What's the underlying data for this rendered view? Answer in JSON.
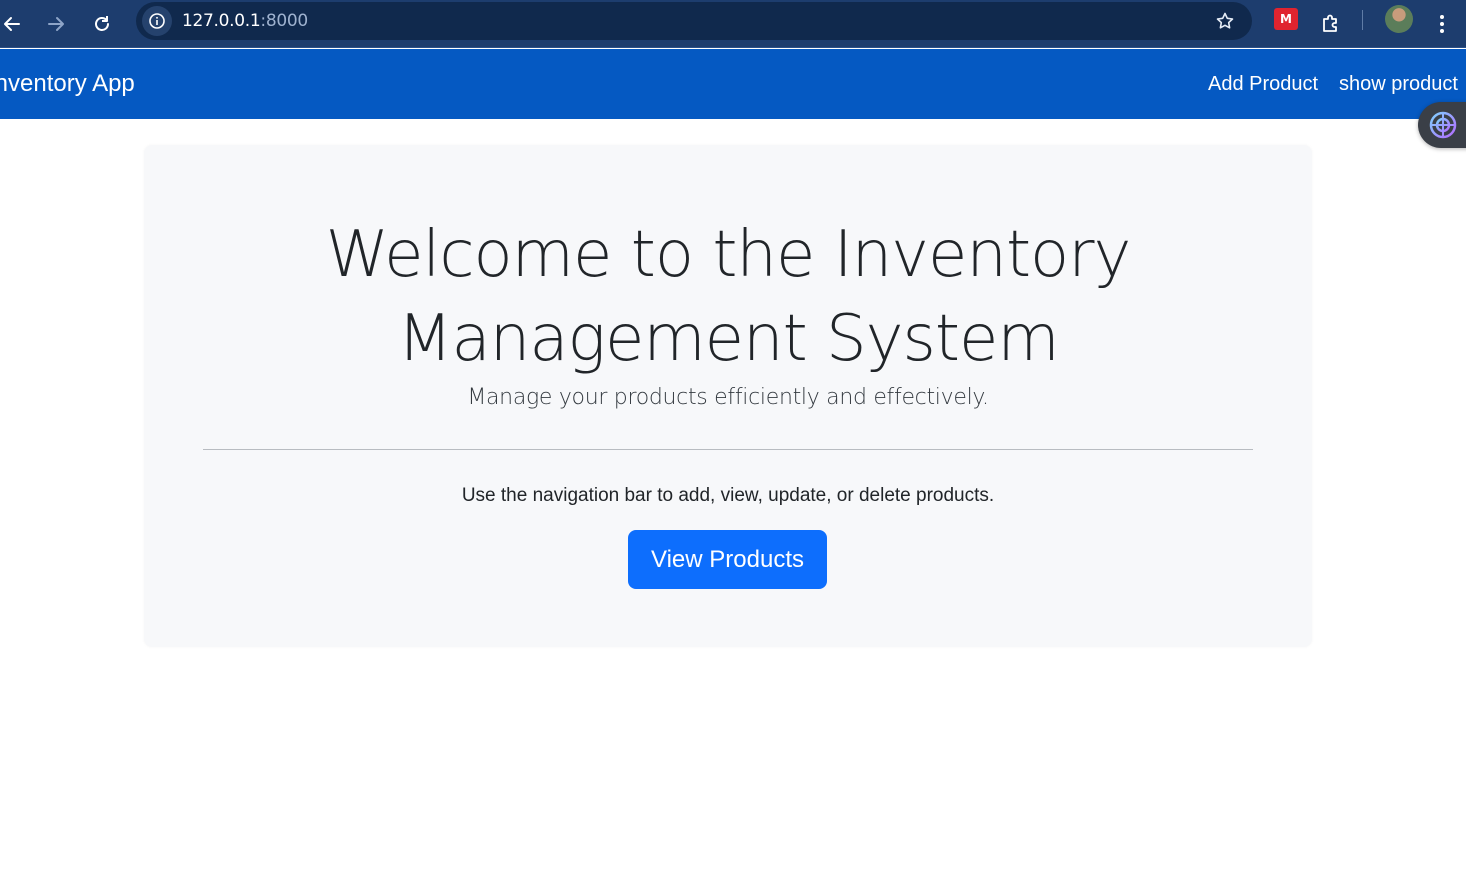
{
  "browser": {
    "url_host": "127.0.0.1",
    "url_port": ":8000",
    "icons": [
      "back-arrow-icon",
      "forward-arrow-icon",
      "reload-icon",
      "site-info-icon",
      "bookmark-star-icon",
      "extension-icon",
      "puzzle-icon",
      "profile-avatar",
      "menu-kebab-icon"
    ]
  },
  "navbar": {
    "brand": "Inventory App",
    "links": [
      "Add Product",
      "show product"
    ],
    "color": "#0559c2"
  },
  "hero": {
    "title_line1": "Welcome to the Inventory",
    "title_line2": "Management System",
    "lead": "Manage your products efficiently and effectively.",
    "body": "Use the navigation bar to add, view, update, or delete products.",
    "button_label": "View Products",
    "button_color": "#0d6efd"
  }
}
